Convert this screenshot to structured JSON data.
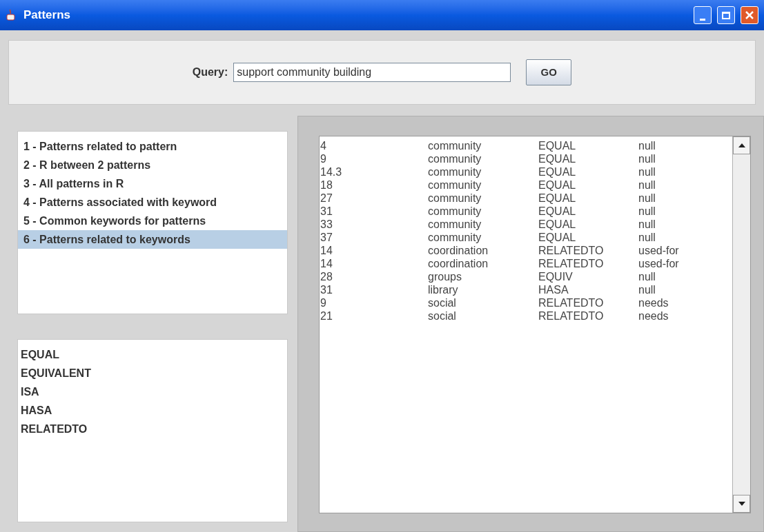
{
  "window": {
    "title": "Patterns"
  },
  "query": {
    "label": "Query:",
    "value": "support community building",
    "button": "GO"
  },
  "operations": [
    {
      "label": "1 - Patterns related to pattern",
      "selected": false
    },
    {
      "label": "2 - R between 2 patterns",
      "selected": false
    },
    {
      "label": "3 - All patterns in R",
      "selected": false
    },
    {
      "label": "4 - Patterns associated with keyword",
      "selected": false
    },
    {
      "label": "5 - Common keywords for patterns",
      "selected": false
    },
    {
      "label": "6 - Patterns related to keywords",
      "selected": true
    }
  ],
  "relations": [
    "EQUAL",
    "EQUIVALENT",
    "ISA",
    "HASA",
    "RELATEDTO"
  ],
  "results": [
    [
      "4",
      "community",
      "EQUAL",
      "null"
    ],
    [
      "9",
      "community",
      "EQUAL",
      "null"
    ],
    [
      "14.3",
      "community",
      "EQUAL",
      "null"
    ],
    [
      "18",
      "community",
      "EQUAL",
      "null"
    ],
    [
      "27",
      "community",
      "EQUAL",
      "null"
    ],
    [
      "31",
      "community",
      "EQUAL",
      "null"
    ],
    [
      "33",
      "community",
      "EQUAL",
      "null"
    ],
    [
      "37",
      "community",
      "EQUAL",
      "null"
    ],
    [
      "14",
      "coordination",
      "RELATEDTO",
      "used-for"
    ],
    [
      "14",
      "coordination",
      "RELATEDTO",
      "used-for"
    ],
    [
      "28",
      "groups",
      "EQUIV",
      "null"
    ],
    [
      "31",
      "library",
      "HASA",
      "null"
    ],
    [
      "9",
      "social",
      "RELATEDTO",
      "needs"
    ],
    [
      "21",
      "social",
      "RELATEDTO",
      "needs"
    ]
  ]
}
